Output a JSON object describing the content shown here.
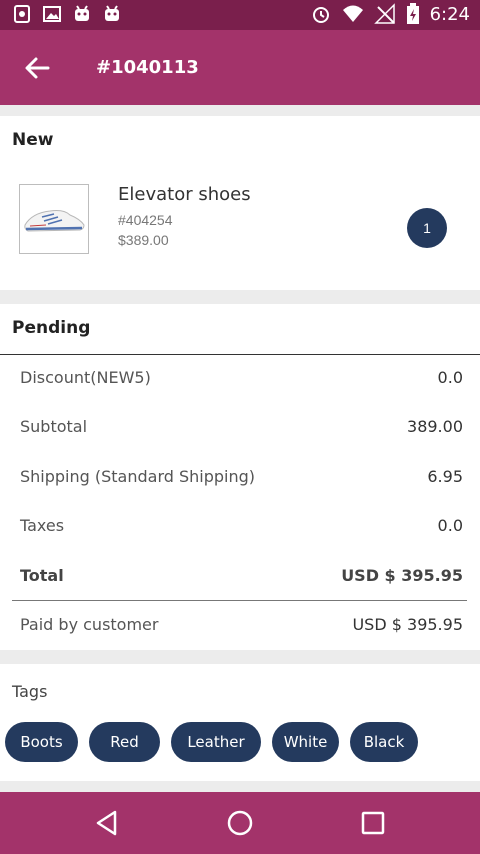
{
  "status_bar": {
    "time": "6:24"
  },
  "app_bar": {
    "title": "#1040113"
  },
  "order": {
    "status": "New",
    "item": {
      "name": "Elevator shoes",
      "sku": "#404254",
      "price": "$389.00",
      "quantity": "1"
    }
  },
  "payment": {
    "status": "Pending",
    "rows": [
      {
        "label": "Discount(NEW5)",
        "value": "0.0"
      },
      {
        "label": "Subtotal",
        "value": "389.00"
      },
      {
        "label": "Shipping (Standard Shipping)",
        "value": "6.95"
      },
      {
        "label": "Taxes",
        "value": "0.0"
      }
    ],
    "total": {
      "label": "Total",
      "value": "USD $ 395.95"
    },
    "paid": {
      "label": "Paid by customer",
      "value": "USD $ 395.95"
    }
  },
  "tags": {
    "label": "Tags",
    "items": [
      "Boots",
      "Red",
      "Leather",
      "White",
      "Black"
    ]
  },
  "colors": {
    "primary": "#a3336a",
    "primary_dark": "#7a1f4c",
    "chip": "#243a5e"
  }
}
